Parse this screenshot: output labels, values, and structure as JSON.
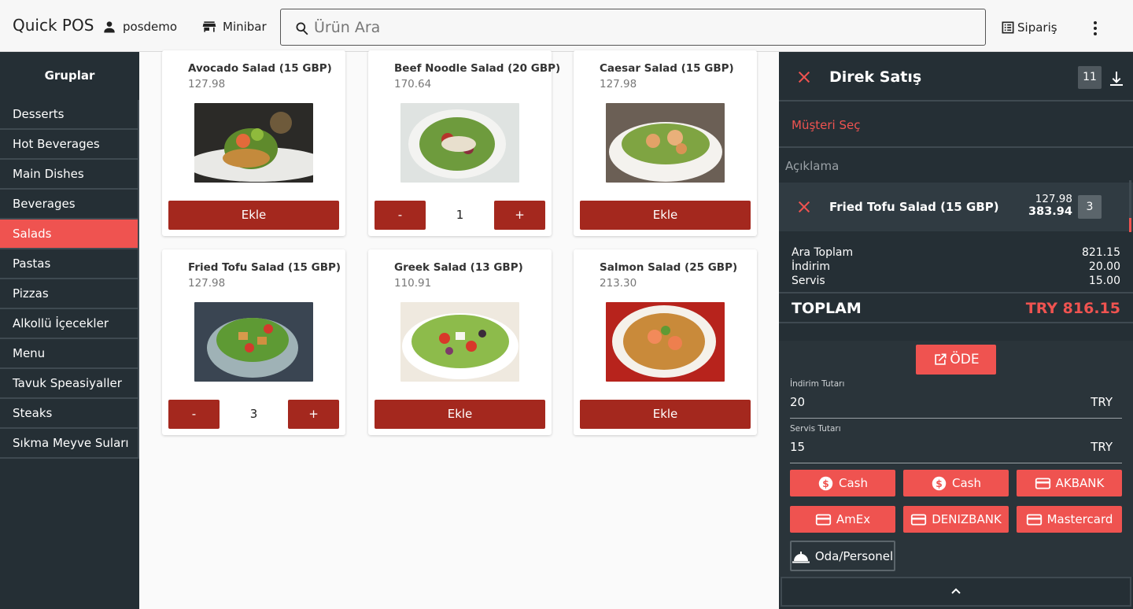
{
  "header": {
    "app_title": "Quick POS",
    "user": "posdemo",
    "minibar": "Minibar",
    "search_placeholder": "Ürün Ara",
    "order": "Sipariş",
    "icons": [
      "person-icon",
      "store-icon",
      "search-icon",
      "list-icon",
      "more-vert-icon"
    ]
  },
  "sidebar": {
    "title": "Gruplar",
    "items": [
      {
        "label": "Desserts",
        "active": false
      },
      {
        "label": "Hot Beverages",
        "active": false
      },
      {
        "label": "Main Dishes",
        "active": false
      },
      {
        "label": "Beverages",
        "active": false
      },
      {
        "label": "Salads",
        "active": true
      },
      {
        "label": "Pastas",
        "active": false
      },
      {
        "label": "Pizzas",
        "active": false
      },
      {
        "label": "Alkollü İçecekler",
        "active": false
      },
      {
        "label": "Menu",
        "active": false
      },
      {
        "label": "Tavuk Speasiyaller",
        "active": false
      },
      {
        "label": "Steaks",
        "active": false
      },
      {
        "label": "Sıkma Meyve Suları",
        "active": false
      }
    ]
  },
  "products": [
    {
      "name": "Avocado Salad (15 GBP)",
      "price": "127.98",
      "add_label": "Ekle",
      "qty": null,
      "minus": "-",
      "plus": "+"
    },
    {
      "name": "Beef Noodle Salad (20 GBP)",
      "price": "170.64",
      "add_label": "Ekle",
      "qty": "1",
      "minus": "-",
      "plus": "+"
    },
    {
      "name": "Caesar Salad (15 GBP)",
      "price": "127.98",
      "add_label": "Ekle",
      "qty": null,
      "minus": "-",
      "plus": "+"
    },
    {
      "name": "Fried Tofu Salad (15 GBP)",
      "price": "127.98",
      "add_label": "Ekle",
      "qty": "3",
      "minus": "-",
      "plus": "+"
    },
    {
      "name": "Greek Salad (13 GBP)",
      "price": "110.91",
      "add_label": "Ekle",
      "qty": null,
      "minus": "-",
      "plus": "+"
    },
    {
      "name": "Salmon Salad (25 GBP)",
      "price": "213.30",
      "add_label": "Ekle",
      "qty": null,
      "minus": "-",
      "plus": "+"
    }
  ],
  "panel": {
    "title": "Direk Satış",
    "item_count": "11",
    "customer_select": "Müşteri Seç",
    "description_placeholder": "Açıklama",
    "order_line": {
      "name": "Fried Tofu Salad (15 GBP)",
      "unit_price": "127.98",
      "total": "383.94",
      "qty": "3"
    },
    "totals": {
      "subtotal_label": "Ara Toplam",
      "subtotal": "821.15",
      "discount_label": "İndirim",
      "discount": "20.00",
      "service_label": "Servis",
      "service": "15.00"
    },
    "grand_label": "TOPLAM",
    "grand_value": "TRY 816.15",
    "pay_label": "ÖDE",
    "discount_field": {
      "label": "İndirim Tutarı",
      "value": "20",
      "currency": "TRY"
    },
    "service_field": {
      "label": "Servis Tutarı",
      "value": "15",
      "currency": "TRY"
    },
    "methods": [
      {
        "label": "Cash",
        "icon": "dollar-circle-icon"
      },
      {
        "label": "Cash",
        "icon": "dollar-circle-icon"
      },
      {
        "label": "AKBANK",
        "icon": "credit-card-icon"
      },
      {
        "label": "AmEx",
        "icon": "credit-card-icon"
      },
      {
        "label": "DENIZBANK",
        "icon": "credit-card-icon"
      },
      {
        "label": "Mastercard",
        "icon": "credit-card-icon"
      }
    ],
    "room_label": "Oda/Personel"
  },
  "colors": {
    "accent": "#ef5350",
    "button_dark_red": "#a4281e",
    "sidebar_bg": "#252f35",
    "panel_bg": "#252f35"
  }
}
